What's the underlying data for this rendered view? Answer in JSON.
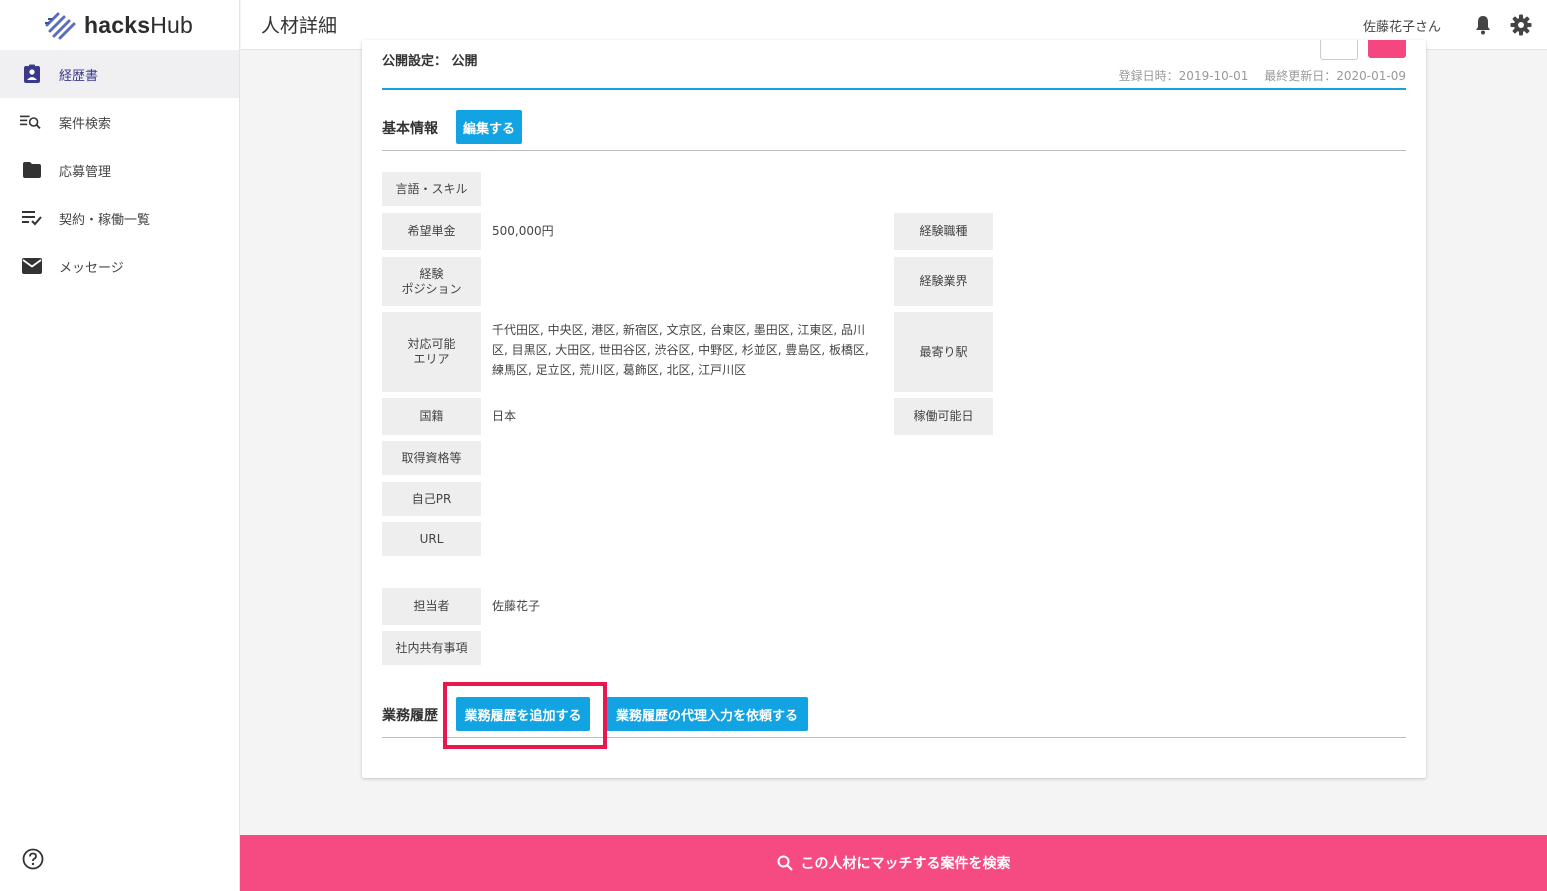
{
  "app": {
    "logo_text_bold": "hacks",
    "logo_text_rest": "Hub"
  },
  "sidebar": {
    "items": [
      {
        "label": "経歴書",
        "icon": "resume-icon",
        "active": true
      },
      {
        "label": "案件検索",
        "icon": "search-list-icon"
      },
      {
        "label": "応募管理",
        "icon": "folder-icon"
      },
      {
        "label": "契約・稼働一覧",
        "icon": "checklist-icon"
      },
      {
        "label": "メッセージ",
        "icon": "mail-icon"
      }
    ]
  },
  "header": {
    "title": "人材詳細",
    "user": "佐藤花子さん"
  },
  "card": {
    "publish": "公開設定： 公開",
    "registered": "登録日時：2019-10-01",
    "updated": "最終更新日：2020-01-09",
    "basic": {
      "title": "基本情報",
      "edit_button": "編集する",
      "fields": {
        "skills": {
          "label": "言語・スキル",
          "value": ""
        },
        "rate": {
          "label": "希望単金",
          "value": "500,000円"
        },
        "position": {
          "label": "経験ポジション",
          "label_l1": "経験",
          "label_l2": "ポジション",
          "value": ""
        },
        "area": {
          "label_l1": "対応可能",
          "label_l2": "エリア",
          "value": "千代田区, 中央区, 港区, 新宿区, 文京区, 台東区, 墨田区, 江東区, 品川区, 目黒区, 大田区, 世田谷区, 渋谷区, 中野区, 杉並区, 豊島区, 板橋区, 練馬区, 足立区, 荒川区, 葛飾区, 北区, 江戸川区"
        },
        "nationality": {
          "label": "国籍",
          "value": "日本"
        },
        "qualification": {
          "label": "取得資格等",
          "value": ""
        },
        "pr": {
          "label": "自己PR",
          "value": ""
        },
        "url": {
          "label": "URL",
          "value": ""
        },
        "job_type": {
          "label": "経験職種",
          "value": ""
        },
        "industry": {
          "label": "経験業界",
          "value": ""
        },
        "station": {
          "label": "最寄り駅",
          "value": ""
        },
        "available": {
          "label": "稼働可能日",
          "value": ""
        },
        "manager": {
          "label": "担当者",
          "value": "佐藤花子"
        },
        "internal": {
          "label": "社内共有事項",
          "value": ""
        }
      }
    },
    "history": {
      "title": "業務履歴",
      "add_button": "業務履歴を追加する",
      "proxy_button": "業務履歴の代理入力を依頼する"
    }
  },
  "bottom_bar": {
    "label": "この人材にマッチする案件を検索"
  },
  "colors": {
    "accent_blue": "#12a3e3",
    "accent_pink": "#f54a82",
    "highlight_red": "#e8184e",
    "nav_active": "#3b3a8a"
  }
}
